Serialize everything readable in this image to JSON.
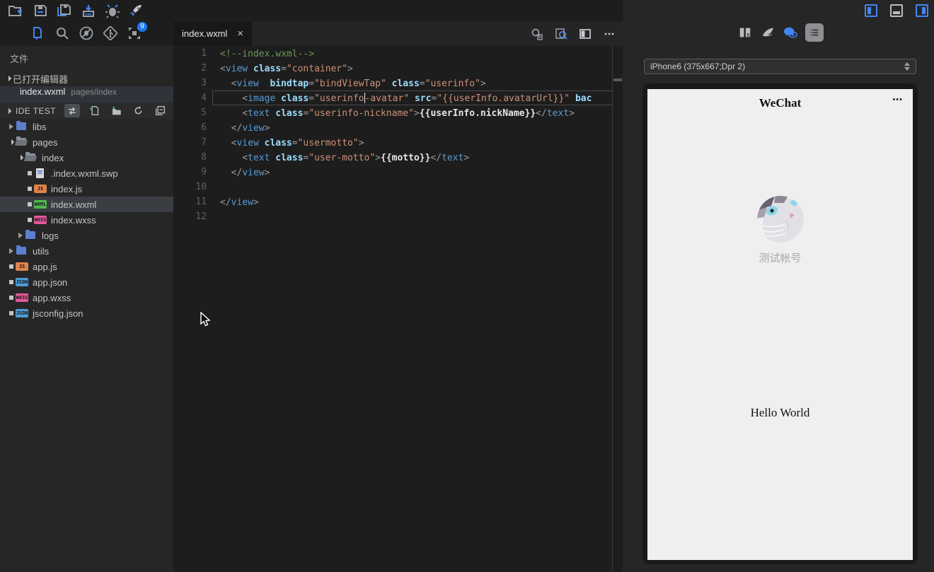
{
  "topbar": {
    "icons": [
      {
        "name": "new-project"
      },
      {
        "name": "save"
      },
      {
        "name": "save-all"
      },
      {
        "name": "build-upload"
      },
      {
        "name": "debug"
      },
      {
        "name": "launch"
      }
    ]
  },
  "activity_bar": {
    "icons": [
      {
        "name": "files"
      },
      {
        "name": "search"
      },
      {
        "name": "debug-disabled"
      },
      {
        "name": "git"
      },
      {
        "name": "opened-windows"
      }
    ],
    "badge_count": "9"
  },
  "window_toggles": [
    {
      "name": "toggle-left-panel",
      "active": true
    },
    {
      "name": "toggle-bottom-panel",
      "active": false
    },
    {
      "name": "toggle-right-panel",
      "active": true
    }
  ],
  "sidebar": {
    "title": "文件",
    "open_editors": {
      "label": "已打开编辑器",
      "items": [
        {
          "file": "index.wxml",
          "path": "pages/index"
        }
      ]
    },
    "project": {
      "name": "IDE TEST",
      "actions": [
        {
          "name": "compare-swap"
        },
        {
          "name": "new-file"
        },
        {
          "name": "new-folder"
        },
        {
          "name": "refresh"
        },
        {
          "name": "collapse-all"
        }
      ]
    },
    "tree": [
      {
        "label": "libs",
        "indent": 1,
        "kind": "folder",
        "state": "collapsed"
      },
      {
        "label": "pages",
        "indent": 1,
        "kind": "folder-open",
        "state": "expanded"
      },
      {
        "label": "index",
        "indent": 2,
        "kind": "folder-open",
        "state": "expanded"
      },
      {
        "label": ".index.wxml.swp",
        "indent": 3,
        "kind": "doc"
      },
      {
        "label": "index.js",
        "indent": 3,
        "kind": "badge",
        "badge": "JS",
        "color": "#e0824b"
      },
      {
        "label": "index.wxml",
        "indent": 3,
        "kind": "badge",
        "badge": "WXML",
        "color": "#53b84f",
        "selected": true
      },
      {
        "label": "index.wxss",
        "indent": 3,
        "kind": "badge",
        "badge": "WXSS",
        "color": "#e25a9c"
      },
      {
        "label": "logs",
        "indent": 2,
        "kind": "folder",
        "state": "collapsed"
      },
      {
        "label": "utils",
        "indent": 1,
        "kind": "folder",
        "state": "collapsed"
      },
      {
        "label": "app.js",
        "indent": 1,
        "kind": "badge",
        "badge": "JS",
        "color": "#e0824b"
      },
      {
        "label": "app.json",
        "indent": 1,
        "kind": "badge",
        "badge": "JSON",
        "color": "#4f9cd6"
      },
      {
        "label": "app.wxss",
        "indent": 1,
        "kind": "badge",
        "badge": "WXSS",
        "color": "#e25a9c"
      },
      {
        "label": "jsconfig.json",
        "indent": 1,
        "kind": "badge",
        "badge": "JSON",
        "color": "#4f9cd6"
      }
    ]
  },
  "editor": {
    "tab": {
      "label": "index.wxml",
      "close": "×"
    },
    "actions": [
      {
        "name": "find-in-file"
      },
      {
        "name": "search-preview"
      },
      {
        "name": "split-editor"
      },
      {
        "name": "more-actions"
      }
    ],
    "code": {
      "lines": [
        {
          "n": "1",
          "s": [
            {
              "c": "com",
              "t": "<!--index.wxml-->"
            }
          ]
        },
        {
          "n": "2",
          "s": [
            {
              "c": "pun",
              "t": "<"
            },
            {
              "c": "tag",
              "t": "view"
            },
            {
              "c": "pun",
              "t": " "
            },
            {
              "c": "attr",
              "t": "class"
            },
            {
              "c": "pun",
              "t": "="
            },
            {
              "c": "str",
              "t": "\"container\""
            },
            {
              "c": "pun",
              "t": ">"
            }
          ]
        },
        {
          "n": "3",
          "s": [
            {
              "c": "pun",
              "t": "  <"
            },
            {
              "c": "tag",
              "t": "view"
            },
            {
              "c": "pun",
              "t": "  "
            },
            {
              "c": "attr",
              "t": "bindtap"
            },
            {
              "c": "pun",
              "t": "="
            },
            {
              "c": "str",
              "t": "\"bindViewTap\""
            },
            {
              "c": "pun",
              "t": " "
            },
            {
              "c": "attr",
              "t": "class"
            },
            {
              "c": "pun",
              "t": "="
            },
            {
              "c": "str",
              "t": "\"userinfo\""
            },
            {
              "c": "pun",
              "t": ">"
            }
          ]
        },
        {
          "n": "4",
          "current": true,
          "s": [
            {
              "c": "pun",
              "t": "    <"
            },
            {
              "c": "tag",
              "t": "image"
            },
            {
              "c": "pun",
              "t": " "
            },
            {
              "c": "attr",
              "t": "class"
            },
            {
              "c": "pun",
              "t": "="
            },
            {
              "c": "str",
              "t": "\"userinfo"
            },
            {
              "cursor": true
            },
            {
              "c": "str",
              "t": "-avatar\""
            },
            {
              "c": "pun",
              "t": " "
            },
            {
              "c": "attr",
              "t": "src"
            },
            {
              "c": "pun",
              "t": "="
            },
            {
              "c": "str",
              "t": "\"{{userInfo.avatarUrl}}\""
            },
            {
              "c": "pun",
              "t": " "
            },
            {
              "c": "attr",
              "t": "bac"
            }
          ]
        },
        {
          "n": "5",
          "s": [
            {
              "c": "pun",
              "t": "    <"
            },
            {
              "c": "tag",
              "t": "text"
            },
            {
              "c": "pun",
              "t": " "
            },
            {
              "c": "attr",
              "t": "class"
            },
            {
              "c": "pun",
              "t": "="
            },
            {
              "c": "str",
              "t": "\"userinfo-nickname\""
            },
            {
              "c": "pun",
              "t": ">"
            },
            {
              "c": "txt",
              "t": "{{userInfo.nickName}}"
            },
            {
              "c": "pun",
              "t": "</"
            },
            {
              "c": "tag",
              "t": "text"
            },
            {
              "c": "pun",
              "t": ">"
            }
          ]
        },
        {
          "n": "6",
          "s": [
            {
              "c": "pun",
              "t": "  </"
            },
            {
              "c": "tag",
              "t": "view"
            },
            {
              "c": "pun",
              "t": ">"
            }
          ]
        },
        {
          "n": "7",
          "s": [
            {
              "c": "pun",
              "t": "  <"
            },
            {
              "c": "tag",
              "t": "view"
            },
            {
              "c": "pun",
              "t": " "
            },
            {
              "c": "attr",
              "t": "class"
            },
            {
              "c": "pun",
              "t": "="
            },
            {
              "c": "str",
              "t": "\"usermotto\""
            },
            {
              "c": "pun",
              "t": ">"
            }
          ]
        },
        {
          "n": "8",
          "s": [
            {
              "c": "pun",
              "t": "    <"
            },
            {
              "c": "tag",
              "t": "text"
            },
            {
              "c": "pun",
              "t": " "
            },
            {
              "c": "attr",
              "t": "class"
            },
            {
              "c": "pun",
              "t": "="
            },
            {
              "c": "str",
              "t": "\"user-motto\""
            },
            {
              "c": "pun",
              "t": ">"
            },
            {
              "c": "txt",
              "t": "{{motto}}"
            },
            {
              "c": "pun",
              "t": "</"
            },
            {
              "c": "tag",
              "t": "text"
            },
            {
              "c": "pun",
              "t": ">"
            }
          ]
        },
        {
          "n": "9",
          "s": [
            {
              "c": "pun",
              "t": "  </"
            },
            {
              "c": "tag",
              "t": "view"
            },
            {
              "c": "pun",
              "t": ">"
            }
          ]
        },
        {
          "n": "10",
          "s": []
        },
        {
          "n": "11",
          "s": [
            {
              "c": "pun",
              "t": "</"
            },
            {
              "c": "tag",
              "t": "view"
            },
            {
              "c": "pun",
              "t": ">"
            }
          ]
        },
        {
          "n": "12",
          "s": []
        }
      ]
    }
  },
  "simulator": {
    "device_select": "iPhone6 (375x667;Dpr 2)",
    "toolbar": [
      {
        "name": "docs-book"
      },
      {
        "name": "wing"
      },
      {
        "name": "wechat-preview"
      },
      {
        "name": "console-list"
      }
    ],
    "screen": {
      "title": "WeChat",
      "menu_dots": "•••",
      "nickname": "测试帐号",
      "motto": "Hello World"
    }
  },
  "colors": {
    "accent_blue": "#4285f4",
    "badge_blue": "#1d79f2",
    "syntax_tag": "#569cd6",
    "syntax_attr": "#9cdcfe",
    "syntax_string": "#ce9178",
    "syntax_comment": "#6a9955",
    "wxml_green": "#53b84f",
    "wxss_pink": "#e25a9c",
    "js_orange": "#e0824b",
    "json_blue": "#4f9cd6"
  }
}
